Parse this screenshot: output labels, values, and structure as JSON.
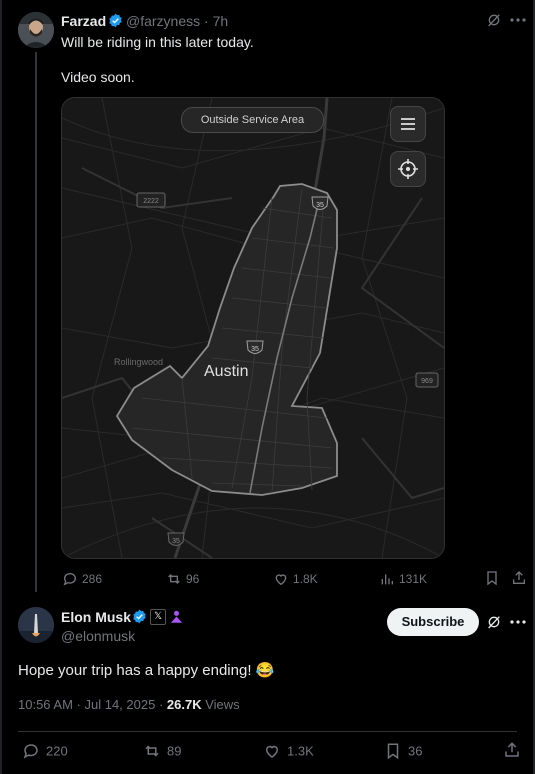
{
  "tweet": {
    "author_name": "Farzad",
    "author_handle": "@farzyness",
    "separator": "·",
    "time": "7h",
    "line1": "Will be riding in this later today.",
    "line2": "Video soon.",
    "map": {
      "service_label": "Outside Service Area",
      "city_label": "Austin",
      "suburb_label": "Rollingwood",
      "shield_labels": [
        "35",
        "35",
        "35",
        "2222",
        "969"
      ]
    },
    "stats": {
      "replies": "286",
      "reposts": "96",
      "likes": "1.8K",
      "views": "131K"
    }
  },
  "reply": {
    "author_name": "Elon Musk",
    "author_handle": "@elonmusk",
    "x_badge": "𝕏",
    "subscribe_label": "Subscribe",
    "text": "Hope your trip has a happy ending! 😂",
    "timestamp": "10:56 AM · Jul 14, 2025",
    "meta_separator": "·",
    "views_count": "26.7K",
    "views_label": "Views",
    "stats": {
      "replies": "220",
      "reposts": "89",
      "likes": "1.3K",
      "bookmarks": "36"
    }
  },
  "colors": {
    "background": "#000000",
    "verified_blue": "#1d9bf0",
    "muted_text": "#71767b",
    "affiliate_purple": "#a855f7"
  }
}
